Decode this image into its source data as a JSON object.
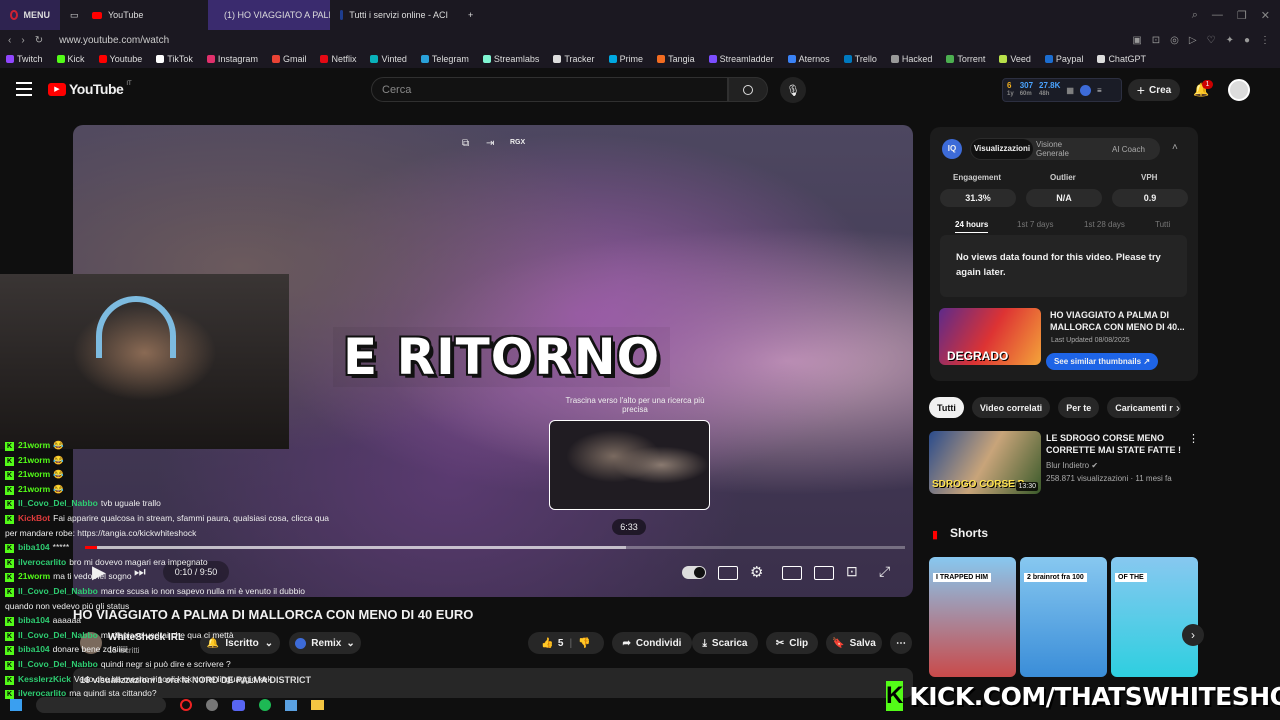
{
  "tabs": [
    {
      "label": "MENU",
      "icon": "opera-icon"
    },
    {
      "label": "YouTube",
      "icon": "youtube-icon"
    },
    {
      "label": "(1) HO VIAGGIATO A PALI",
      "icon": "youtube-icon"
    },
    {
      "label": "Tutti i servizi online - ACI",
      "icon": "aci-icon"
    }
  ],
  "address": {
    "url": "www.youtube.com/watch"
  },
  "bookmarks": [
    {
      "label": "Twitch",
      "color": "#9146ff"
    },
    {
      "label": "Kick",
      "color": "#53fc18"
    },
    {
      "label": "Youtube",
      "color": "#ff0000"
    },
    {
      "label": "TikTok",
      "color": "#ffffff"
    },
    {
      "label": "Instagram",
      "color": "#e1306c"
    },
    {
      "label": "Gmail",
      "color": "#ea4335"
    },
    {
      "label": "Netflix",
      "color": "#e50914"
    },
    {
      "label": "Vinted",
      "color": "#09b1ba"
    },
    {
      "label": "Telegram",
      "color": "#2aa1da"
    },
    {
      "label": "Streamlabs",
      "color": "#80f5d2"
    },
    {
      "label": "Tracker",
      "color": "#dddddd"
    },
    {
      "label": "Prime",
      "color": "#00a8e1"
    },
    {
      "label": "Tangia",
      "color": "#f36c21"
    },
    {
      "label": "Streamladder",
      "color": "#7c4dff"
    },
    {
      "label": "Aternos",
      "color": "#3b82f6"
    },
    {
      "label": "Trello",
      "color": "#0079bf"
    },
    {
      "label": "Hacked",
      "color": "#999999"
    },
    {
      "label": "Torrent",
      "color": "#4caf50"
    },
    {
      "label": "Veed",
      "color": "#b8e04a"
    },
    {
      "label": "Paypal",
      "color": "#1c6dd0"
    },
    {
      "label": "ChatGPT",
      "color": "#dddddd"
    }
  ],
  "youtube": {
    "logo_text": "YouTube",
    "logo_region": "IT",
    "search_placeholder": "Cerca",
    "create_label": "Crea",
    "notification_count": "1",
    "stats_widget": {
      "a": "6",
      "a_sub": "1y",
      "b": "307",
      "b_sub": "60m",
      "c": "27.8K",
      "c_sub": "48h"
    }
  },
  "video": {
    "overlay_text": "E RITORNO",
    "rgx_label": "RGX",
    "drag_hint": "Trascina verso l'alto per una ricerca più precisa",
    "preview_time": "6:33",
    "time_display": "0:10 / 9:50",
    "progress": 0.66,
    "title": "HO VIAGGIATO A PALMA DI MALLORCA CON MENO DI 40 EURO",
    "channel_name": "WhiteShock IRL",
    "subscribers": "15 iscritti",
    "subscribed_label": "Iscritto",
    "remix_label": "Remix",
    "likes": "5",
    "share_label": "Condividi",
    "download_label": "Scarica",
    "clip_label": "Clip",
    "save_label": "Salva",
    "description_meta": "16 visualizzazioni  1 ora fa  NORD DE PALMA DISTRICT"
  },
  "vidiq": {
    "tabs": [
      "Visualizzazioni",
      "Visione Generale",
      "AI Coach"
    ],
    "stats": [
      {
        "label": "Engagement",
        "value": "31.3%"
      },
      {
        "label": "Outlier",
        "value": "N/A"
      },
      {
        "label": "VPH",
        "value": "0.9"
      }
    ],
    "ranges": [
      "24 hours",
      "1st 7 days",
      "1st 28 days",
      "Tutti"
    ],
    "no_data": "No views data found for this video. Please try again later.",
    "thumb_title": "HO VIAGGIATO A PALMA DI MALLORCA CON MENO DI 40...",
    "thumb_text": "DEGRADO",
    "last_updated": "Last Updated 08/08/2025",
    "similar_button": "See similar thumbnails"
  },
  "chips": [
    "Tutti",
    "Video correlati",
    "Per te",
    "Caricamenti r"
  ],
  "related": {
    "title": "LE SDROGO CORSE MENO CORRETTE MAI STATE FATTE !",
    "channel": "Blur Indietro",
    "meta": "258.871 visualizzazioni · 11 mesi fa",
    "duration": "13:30",
    "thumb_text": "SDROGO CORSE P"
  },
  "shorts": {
    "heading": "Shorts",
    "items": [
      {
        "caption": "I TRAPPED HIM",
        "color": "#c94a4a"
      },
      {
        "caption": "2 brainrot fra 100",
        "color": "#3a8dd8"
      },
      {
        "caption": "OF THE",
        "color": "#2ecfe0"
      }
    ]
  },
  "stream_overlay": {
    "kick_url": "KICK.COM/THATSWHITESHOCK",
    "chat": [
      {
        "user": "21worm",
        "color": "#53fc18",
        "text": "😂"
      },
      {
        "user": "21worm",
        "color": "#53fc18",
        "text": "😂"
      },
      {
        "user": "21worm",
        "color": "#53fc18",
        "text": "😂"
      },
      {
        "user": "21worm",
        "color": "#53fc18",
        "text": "😂"
      },
      {
        "user": "Il_Covo_Del_Nabbo",
        "color": "#2ecc71",
        "text": "tvb uguale trallo"
      },
      {
        "user": "KickBot",
        "color": "#e03c3c",
        "text": "Fai apparire qualcosa in stream, sfammi paura, qualsiasi cosa, clicca qua"
      },
      {
        "user": "",
        "color": "#ffffff",
        "text": "per mandare robe: https://tangia.co/kickwhiteshock"
      },
      {
        "user": "biba104",
        "color": "#2ecc71",
        "text": "*****"
      },
      {
        "user": "ilverocarlito",
        "color": "#2ecc71",
        "text": "bro mi dovevo magari era impegnato"
      },
      {
        "user": "21worm",
        "color": "#53fc18",
        "text": "ma ti vedo nel sogno"
      },
      {
        "user": "Il_Covo_Del_Nabbo",
        "color": "#2ecc71",
        "text": "marce scusa io non sapevo nulla mi è venuto il dubbio"
      },
      {
        "user": "",
        "color": "#ffffff",
        "text": "quando non vedevo più gli status"
      },
      {
        "user": "biba104",
        "color": "#2ecc71",
        "text": "aaaaaa"
      },
      {
        "user": "Il_Covo_Del_Nabbo",
        "color": "#2ecc71",
        "text": "mi dispiace vedrai che qua ci mettà"
      },
      {
        "user": "biba104",
        "color": "#2ecc71",
        "text": "donare bene zdaiiiiii"
      },
      {
        "user": "Il_Covo_Del_Nabbo",
        "color": "#2ecc71",
        "text": "quindi negr si può dire e scrivere ?"
      },
      {
        "user": "KesslerzKick",
        "color": "#2ecc71",
        "text": "Vedo che ha mesno vincoli kick come linguaggio kek"
      },
      {
        "user": "ilverocarlito",
        "color": "#2ecc71",
        "text": "ma quindi sta cittando?"
      }
    ]
  }
}
